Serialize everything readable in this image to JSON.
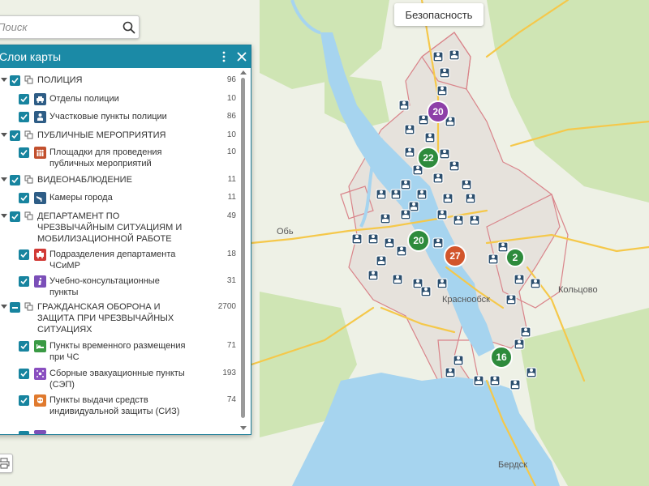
{
  "search": {
    "placeholder": "Поиск"
  },
  "top_button": {
    "label": "Безопасность"
  },
  "layers_panel": {
    "title": "Слои карты",
    "rows": [
      {
        "kind": "group",
        "label": "ПОЛИЦИЯ",
        "count": "96",
        "checked": "full"
      },
      {
        "kind": "layer",
        "label": "Отделы полиции",
        "count": "10",
        "icon": "police-car-icon",
        "color": "#2e5d86"
      },
      {
        "kind": "layer",
        "label": "Участковые пункты полиции",
        "count": "86",
        "icon": "police-officer-icon",
        "color": "#2e5d86"
      },
      {
        "kind": "group",
        "label": "ПУБЛИЧНЫЕ МЕРОПРИЯТИЯ",
        "count": "10",
        "checked": "full"
      },
      {
        "kind": "layer",
        "label": "Площадки для проведения публичных мероприятий",
        "count": "10",
        "icon": "crowd-icon",
        "color": "#c2502e"
      },
      {
        "kind": "group",
        "label": "ВИДЕОНАБЛЮДЕНИЕ",
        "count": "11",
        "checked": "full"
      },
      {
        "kind": "layer",
        "label": "Камеры города",
        "count": "11",
        "icon": "camera-icon",
        "color": "#2e5d86"
      },
      {
        "kind": "group",
        "label": "ДЕПАРТАМЕНТ ПО ЧРЕЗВЫЧАЙНЫМ СИТУАЦИЯМ И МОБИЛИЗАЦИОННОЙ РАБОТЕ",
        "count": "49",
        "checked": "full"
      },
      {
        "kind": "layer",
        "label": "Подразделения департамента ЧСиМР",
        "count": "18",
        "icon": "emergency-unit-icon",
        "color": "#d13a36"
      },
      {
        "kind": "layer",
        "label": "Учебно-консультационные пункты",
        "count": "31",
        "icon": "info-icon",
        "color": "#7b4fb8"
      },
      {
        "kind": "group",
        "label": "ГРАЖДАНСКАЯ ОБОРОНА И ЗАЩИТА ПРИ ЧРЕЗВЫЧАЙНЫХ СИТУАЦИЯХ",
        "count": "2700",
        "checked": "partial"
      },
      {
        "kind": "layer",
        "label": "Пункты временного размещения при ЧС",
        "count": "71",
        "icon": "bed-icon",
        "color": "#3a9a44"
      },
      {
        "kind": "layer",
        "label": "Сборные эвакуационные пункты (СЭП)",
        "count": "193",
        "icon": "evacuation-icon",
        "color": "#8a4fc0"
      },
      {
        "kind": "layer",
        "label": "Пункты выдачи средств индивидуальной защиты (СИЗ)",
        "count": "74",
        "icon": "gas-mask-icon",
        "color": "#e07a2e"
      }
    ]
  },
  "map": {
    "labels": {
      "ob": "Обь",
      "krasnoobsk": "Краснообск",
      "koltsovo": "Кольцово",
      "berdsk": "Бердск"
    },
    "clusters": [
      "20",
      "22",
      "20",
      "27",
      "2",
      "16"
    ],
    "colors": {
      "water": "#a6d4ef",
      "land": "#eef1e6",
      "green": "#cfe5b4",
      "urban": "#e6e2dc",
      "road": "#f5c84a",
      "boundary": "#d9848a",
      "marker": "#2c4f6e",
      "cluster_purple": "#8d3fa8",
      "cluster_green": "#2e8b3c",
      "cluster_orange": "#d2552b",
      "panel_header": "#1b8aa6",
      "checkbox": "#17849f"
    }
  }
}
